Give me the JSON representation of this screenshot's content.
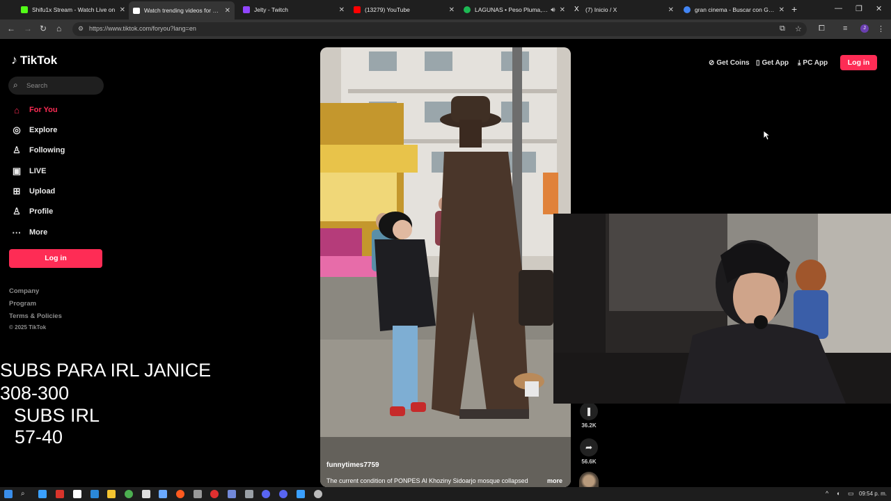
{
  "browser": {
    "tabs": [
      {
        "title": "Shifu1x Stream - Watch Live on",
        "favicon_color": "#53fc18",
        "active": false
      },
      {
        "title": "Watch trending videos for you",
        "favicon_color": "#ffffff",
        "active": true
      },
      {
        "title": "Jelty - Twitch",
        "favicon_color": "#9146ff",
        "active": false
      },
      {
        "title": "(13279) YouTube",
        "favicon_color": "#ff0000",
        "active": false
      },
      {
        "title": "LAGUNAS • Peso Pluma, Je",
        "favicon_color": "#1db954",
        "active": false
      },
      {
        "title": "(7) Inicio / X",
        "favicon_color": "#ffffff",
        "active": false
      },
      {
        "title": "gran cinema - Buscar con Goo",
        "favicon_color": "#4285f4",
        "active": false
      }
    ],
    "url": "https://www.tiktok.com/foryou?lang=en",
    "new_tab": "+",
    "window_controls": [
      "—",
      "❐",
      "✕"
    ],
    "profile_initial": "J"
  },
  "tiktok": {
    "logo_text": "TikTok",
    "search_placeholder": "Search",
    "nav": [
      {
        "label": "For You",
        "icon": "home-icon",
        "glyph": "⌂",
        "active": true
      },
      {
        "label": "Explore",
        "icon": "compass-icon",
        "glyph": "◎",
        "active": false
      },
      {
        "label": "Following",
        "icon": "following-icon",
        "glyph": "♙",
        "active": false
      },
      {
        "label": "LIVE",
        "icon": "live-icon",
        "glyph": "▣",
        "active": false
      },
      {
        "label": "Upload",
        "icon": "upload-icon",
        "glyph": "⊞",
        "active": false
      },
      {
        "label": "Profile",
        "icon": "profile-icon",
        "glyph": "♙",
        "active": false
      },
      {
        "label": "More",
        "icon": "more-icon",
        "glyph": "···",
        "active": false
      }
    ],
    "login_label": "Log in",
    "footer_links": [
      "Company",
      "Program",
      "Terms & Policies"
    ],
    "copyright": "© 2025 TikTok",
    "header_buttons": [
      {
        "label": "Get Coins",
        "icon": "coin-icon",
        "glyph": "⊘"
      },
      {
        "label": "Get App",
        "icon": "phone-icon",
        "glyph": "▯"
      },
      {
        "label": "PC App",
        "icon": "download-icon",
        "glyph": "⤓"
      }
    ],
    "header_login": "Log in",
    "video": {
      "author": "funnytimes7759",
      "caption": "The current condition of PONPES Al Khoziny Sidoarjo mosque collapsed",
      "more": "more"
    },
    "actions": [
      {
        "name": "bookmark",
        "glyph": "❚",
        "count": "36.2K"
      },
      {
        "name": "share",
        "glyph": "➦",
        "count": "56.6K"
      }
    ]
  },
  "overlay": {
    "line1": "SUBS PARA IRL JANICE",
    "line2": "308-300",
    "line3": "SUBS IRL",
    "line4": "57-40"
  },
  "taskbar": {
    "clock": "09:54 p. m.",
    "apps": [
      "#2d7ff9",
      "#e8e8e8",
      "#3aa0ff",
      "#d9342b",
      "#ffffff",
      "#2b88d8",
      "#f4c430",
      "#4caf50",
      "#e0e0e0",
      "#6aa9ff",
      "#ff5a1f",
      "#999999",
      "#e03030",
      "#7289da",
      "#9aa0a6",
      "#5865f2",
      "#5865f2",
      "#3aa0ff",
      "#bbbbbb"
    ]
  }
}
